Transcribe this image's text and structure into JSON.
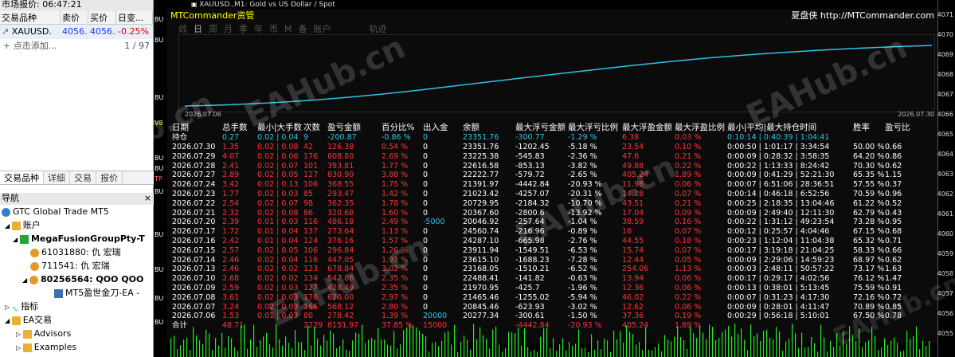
{
  "market_watch": {
    "title": "市场报价: 06:47:21",
    "cols": [
      "交易品种",
      "卖价",
      "买价",
      "日变..."
    ],
    "row": {
      "symbol": "XAUUSD.",
      "bid": "4056....",
      "ask": "4056....",
      "change": "-0.25%"
    },
    "add": "点击添加...",
    "count": "1 / 97",
    "tabs": [
      "交易品种",
      "详细",
      "交易",
      "报价"
    ]
  },
  "navigator": {
    "title": "导航",
    "items": [
      {
        "label": "GTC Global Trade MT5",
        "icon": "globe-icon"
      },
      {
        "label": "账户",
        "icon": "folder-icon"
      },
      {
        "label": "MegaFusionGroupPty-T",
        "icon": "server-icon"
      },
      {
        "label": "61031880: 仇 宏瑞",
        "icon": "user-icon"
      },
      {
        "label": "711541: 仇 宏瑞",
        "icon": "user-icon"
      },
      {
        "label": "80256564: QOO QOO",
        "icon": "user-icon"
      },
      {
        "label": "MT5盈世金刀-EA -",
        "icon": "ea-icon"
      },
      {
        "label": "指标",
        "icon": "indicator-icon"
      },
      {
        "label": "EA交易",
        "icon": "folder-icon"
      },
      {
        "label": "Advisors",
        "icon": "folder-icon"
      },
      {
        "label": "Examples",
        "icon": "folder-icon"
      }
    ]
  },
  "chart_window": {
    "title": "XAUUSD.,M1:  Gold vs US Dollar / Spot"
  },
  "ea_panel": {
    "name": "MTCommander资管",
    "brand": "夏盘侠 http://MTCommander.com",
    "menu": [
      "综",
      "日",
      "周",
      "月",
      "季",
      "年",
      "币",
      "M",
      "备",
      "账户",
      "轨迹"
    ],
    "start_date": "2026.07.06",
    "end_date": "2026.07.30",
    "headers": [
      "日期",
      "总手数",
      "最小|大手数",
      "次数",
      "盈亏金额",
      "百分比%",
      "出入金",
      "余额",
      "最大浮亏金额",
      "最大浮亏比例",
      "最大浮盈金额",
      "最大浮盈比例",
      "最小|平均|最大持仓时间",
      "胜率",
      "盈亏比"
    ],
    "holding": [
      "持仓",
      "0.27",
      "0.02 | 0.04",
      "9",
      "-200.87",
      "-0.86 %",
      "0",
      "23351.76",
      "-300.77",
      "-1.29 %",
      "6.38",
      "0.03 %",
      "0:10:14 | 0:40:39 | 1:04:41",
      "",
      ""
    ],
    "rows": [
      [
        "2026.07.30",
        "1.35",
        "0.02 | 0.08",
        "42",
        "126.38",
        "0.54 %",
        "0",
        "23351.76",
        "-1202.45",
        "-5.18 %",
        "23.54",
        "0.10 %",
        "0:00:50 | 1:01:17 | 3:34:54",
        "50.00 %",
        "0.66"
      ],
      [
        "2026.07.29",
        "4.07",
        "0.02 | 0.06",
        "176",
        "608.80",
        "2.69 %",
        "0",
        "23225.38",
        "-545.83",
        "-2.36 %",
        "47.6",
        "0.21 %",
        "0:00:09 | 0:28:32 | 3:58:35",
        "64.20 %",
        "0.86"
      ],
      [
        "2026.07.28",
        "2.41",
        "0.02 | 0.07",
        "101",
        "393.81",
        "1.77 %",
        "0",
        "22616.58",
        "-853.13",
        "-3.82 %",
        "49.88",
        "0.22 %",
        "0:00:22 | 1:13:33 | 8:24:42",
        "70.30 %",
        "0.62"
      ],
      [
        "2026.07.27",
        "2.89",
        "0.02 | 0.05",
        "127",
        "830.90",
        "3.88 %",
        "0",
        "22222.77",
        "-579.72",
        "-2.65 %",
        "405.24",
        "1.89 %",
        "0:00:09 | 0:41:29 | 52:21:30",
        "65.35 %",
        "1.15"
      ],
      [
        "2026.07.24",
        "3.42",
        "0.02 | 0.13",
        "106",
        "368.55",
        "1.75 %",
        "0",
        "21391.97",
        "-4442.84",
        "-20.93 %",
        "11.98",
        "0.06 %",
        "0:00:07 | 6:51:06 | 28:36:51",
        "57.55 %",
        "0.37"
      ],
      [
        "2026.07.23",
        "1.77",
        "0.02 | 0.03",
        "85",
        "293.47",
        "1.42 %",
        "0",
        "21023.42",
        "-4257.07",
        "-20.31 %",
        "14.28",
        "0.07 %",
        "0:00:14 | 0:46:18 | 6:52:56",
        "70.59 %",
        "0.96"
      ],
      [
        "2026.07.22",
        "2.54",
        "0.02 | 0.07",
        "98",
        "362.35",
        "1.78 %",
        "0",
        "20729.95",
        "-2184.32",
        "-10.70 %",
        "43.51",
        "0.21 %",
        "0:00:25 | 2:18:35 | 13:04:46",
        "61.22 %",
        "0.52"
      ],
      [
        "2026.07.21",
        "2.32",
        "0.02 | 0.08",
        "86",
        "320.68",
        "1.60 %",
        "0",
        "20367.60",
        "-2800.6",
        "-13.92 %",
        "17.04",
        "0.09 %",
        "0:00:09 | 2:49:40 | 12:11:30",
        "62.79 %",
        "0.43"
      ],
      [
        "2026.07.20",
        "2.39",
        "0.01 | 0.03",
        "116",
        "486.18",
        "2.49 %",
        "-5000",
        "20046.92",
        "-257.64",
        "-1.04 %",
        "38.59",
        "0.16 %",
        "0:00:22 | 1:31:12 | 49:23:54",
        "73.28 %",
        "0.95"
      ],
      [
        "2026.07.17",
        "1.72",
        "0.01 | 0.04",
        "137",
        "273.64",
        "1.13 %",
        "0",
        "24560.74",
        "-216.96",
        "-0.89 %",
        "16",
        "0.07 %",
        "0:00:12 | 0:25:57 | 4:04:46",
        "67.15 %",
        "0.68"
      ],
      [
        "2026.07.16",
        "2.42",
        "0.01 | 0.04",
        "124",
        "376.16",
        "1.57 %",
        "0",
        "24287.10",
        "-665.98",
        "-2.76 %",
        "44.55",
        "0.18 %",
        "0:00:23 | 1:12:04 | 11:04:38",
        "65.32 %",
        "0.71"
      ],
      [
        "2026.07.15",
        "2.57",
        "0.02 | 0.05",
        "106",
        "296.84",
        "1.26 %",
        "0",
        "23911.94",
        "-1549.51",
        "-6.53 %",
        "15.74",
        "0.07 %",
        "0:00:17 | 3:19:18 | 21:04:25",
        "58.33 %",
        "0.66"
      ],
      [
        "2026.07.14",
        "2.46",
        "0.02 | 0.04",
        "116",
        "447.05",
        "1.93 %",
        "0",
        "23615.10",
        "-1688.23",
        "-7.28 %",
        "12.44",
        "0.05 %",
        "0:00:09 | 2:29:06 | 14:59:23",
        "68.97 %",
        "0.62"
      ],
      [
        "2026.07.13",
        "2.46",
        "0.02 | 0.02",
        "123",
        "678.84",
        "3.02 %",
        "0",
        "23168.05",
        "-1510.21",
        "-6.52 %",
        "254.06",
        "1.13 %",
        "0:00:03 | 2:48:11 | 50:57:22",
        "73.17 %",
        "1.63"
      ],
      [
        "2026.07.10",
        "2.68",
        "0.02 | 0.02",
        "134",
        "547.86",
        "2.35 %",
        "0",
        "22488.41",
        "-141.82",
        "-0.63 %",
        "13.94",
        "0.06 %",
        "0:00:17 | 0:29:17 | 4:02:56",
        "76.12 %",
        "1.47"
      ],
      [
        "2026.07.09",
        "2.59",
        "0.02 | 0.03",
        "127",
        "428.49",
        "2.35 %",
        "0",
        "21970.95",
        "-425.7",
        "-1.96 %",
        "12.36",
        "0.06 %",
        "0:00:13 | 0:38:01 | 5:13:45",
        "75.59 %",
        "0.91"
      ],
      [
        "2026.07.08",
        "3.61",
        "0.02 | 0.03",
        "176",
        "620.00",
        "2.97 %",
        "0",
        "21465.46",
        "-1255.02",
        "-5.94 %",
        "46.02",
        "0.22 %",
        "0:00:07 | 0:31:23 | 4:17:30",
        "72.16 %",
        "0.72"
      ],
      [
        "2026.07.07",
        "3.24",
        "0.02 | 0.03",
        "166",
        "568.12",
        "2.80 %",
        "0",
        "20845.46",
        "-623.93",
        "-3.02 %",
        "12.62",
        "0.06 %",
        "0:00:09 | 0:28:01 | 4:11:47",
        "70.89 %",
        "0.85"
      ],
      [
        "2026.07.06",
        "1.53",
        "0.01 | 0.03",
        "80",
        "278.42",
        "1.39 %",
        "20000",
        "20277.34",
        "-300.61",
        "-1.50 %",
        "37.36",
        "0.19 %",
        "0:00:29 | 0:56:18 | 5:10:01",
        "67.50 %",
        "0.78"
      ]
    ],
    "total": [
      "合计",
      "48.71",
      "",
      "2229",
      "8151.97",
      "37.85 %",
      "15000",
      "",
      "-4442.84",
      "-20.93 %",
      "405.24",
      "1.89 %",
      "",
      "",
      ""
    ]
  },
  "price_axis": [
    "4071",
    "4070",
    "4069",
    "4068",
    "4067",
    "4066",
    "4065",
    "4064",
    "4063",
    "4062",
    "4061",
    "4060",
    "4059",
    "4058",
    "4057",
    "4056",
    "4055"
  ],
  "left_strip_labels": [
    "BU",
    "BU",
    "BU",
    "V8",
    "BU",
    "BU",
    "TP",
    "BU",
    "BU",
    "BU",
    "BU",
    "BU"
  ],
  "watermark": "EAHub.cn",
  "colors": {
    "equity_line": "#2ec4e8",
    "loss": "#ff3333",
    "volume": "#22ee22",
    "cyan": "#2ec4e8"
  }
}
